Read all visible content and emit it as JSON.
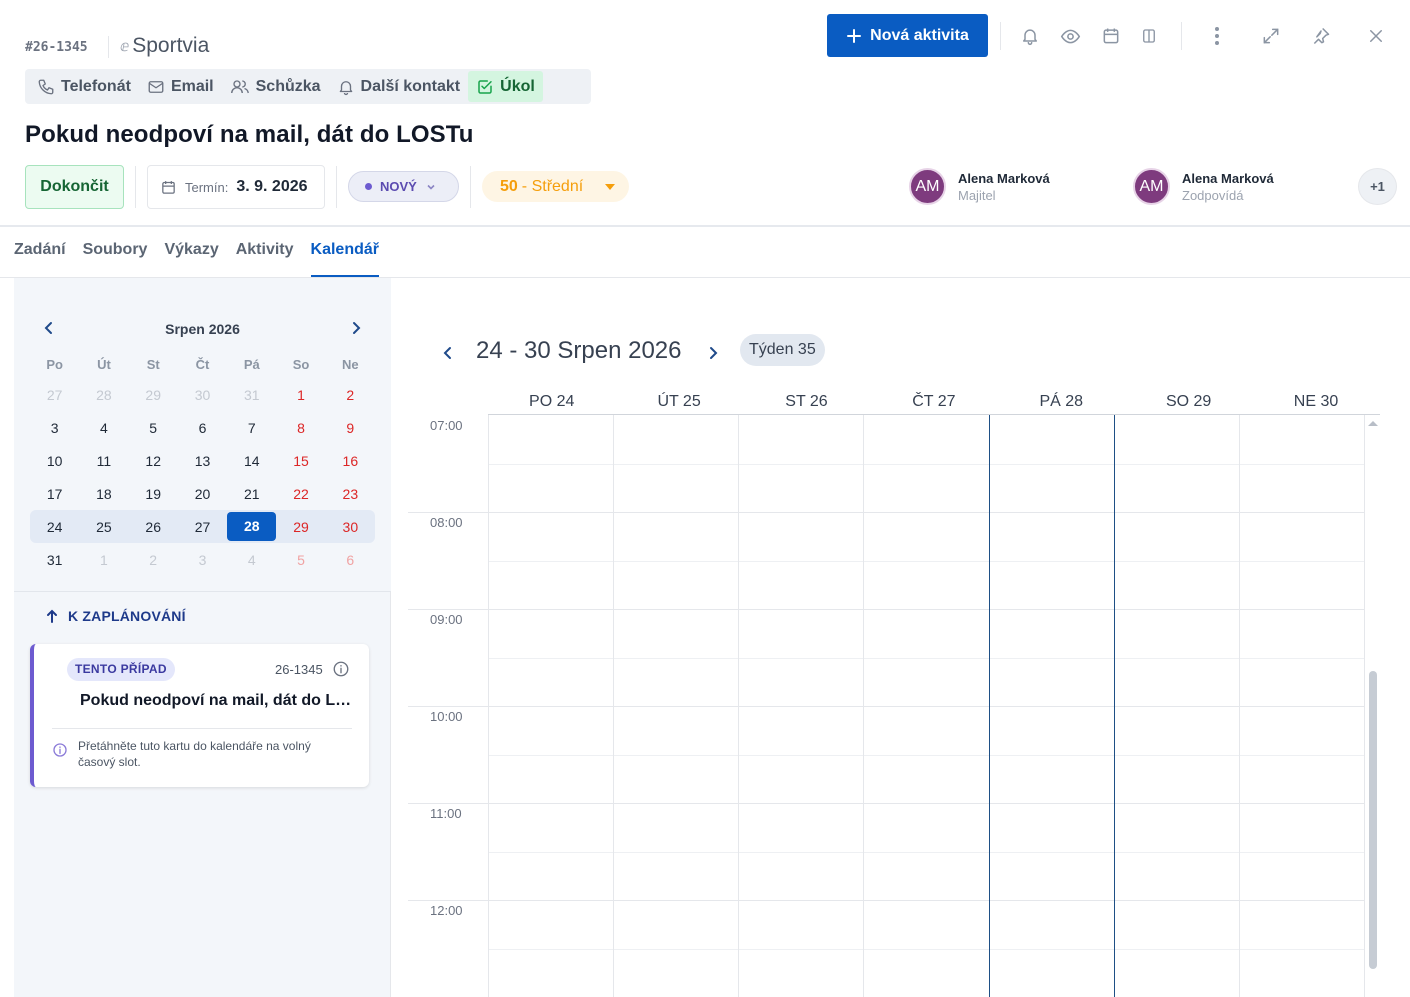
{
  "header": {
    "case_id": "#26-1345",
    "brand": "Sportvia",
    "new_activity_label": "Nová aktivita",
    "activity_types": [
      {
        "label": "Telefonát",
        "icon": "phone-icon"
      },
      {
        "label": "Email",
        "icon": "mail-icon"
      },
      {
        "label": "Schůzka",
        "icon": "users-icon"
      },
      {
        "label": "Další kontakt",
        "icon": "bell-icon"
      },
      {
        "label": "Úkol",
        "icon": "check-square-icon",
        "active": true
      }
    ],
    "toolbar_icons": [
      "bell-icon",
      "eye-icon",
      "calendar-icon",
      "columns-icon",
      "more-vertical-icon",
      "maximize-icon",
      "pin-icon",
      "close-icon"
    ]
  },
  "task": {
    "title": "Pokud neodpoví na mail, dát do LOSTu",
    "finish_label": "Dokončit",
    "deadline_label": "Termín:",
    "deadline_value": "3. 9. 2026",
    "status": "NOVÝ",
    "priority_num": "50",
    "priority_text": "- Střední"
  },
  "people": [
    {
      "initials": "AM",
      "name": "Alena Marková",
      "role": "Majitel"
    },
    {
      "initials": "AM",
      "name": "Alena Marková",
      "role": "Zodpovídá"
    }
  ],
  "more_people": "+1",
  "tabs": [
    {
      "label": "Zadání"
    },
    {
      "label": "Soubory"
    },
    {
      "label": "Výkazy"
    },
    {
      "label": "Aktivity"
    },
    {
      "label": "Kalendář",
      "active": true
    }
  ],
  "mini_calendar": {
    "title": "Srpen 2026",
    "weekdays": [
      "Po",
      "Út",
      "St",
      "Čt",
      "Pá",
      "So",
      "Ne"
    ],
    "weeks": [
      [
        "27",
        "28",
        "29",
        "30",
        "31",
        "1",
        "2"
      ],
      [
        "3",
        "4",
        "5",
        "6",
        "7",
        "8",
        "9"
      ],
      [
        "10",
        "11",
        "12",
        "13",
        "14",
        "15",
        "16"
      ],
      [
        "17",
        "18",
        "19",
        "20",
        "21",
        "22",
        "23"
      ],
      [
        "24",
        "25",
        "26",
        "27",
        "28",
        "29",
        "30"
      ],
      [
        "31",
        "1",
        "2",
        "3",
        "4",
        "5",
        "6"
      ]
    ],
    "today": "28"
  },
  "to_schedule": {
    "heading": "K ZAPLÁNOVÁNÍ",
    "card": {
      "badge": "TENTO PŘÍPAD",
      "id": "26-1345",
      "title": "Pokud neodpoví na mail, dát do LOSTu",
      "hint": "Přetáhněte tuto kartu do kalendáře na volný časový slot."
    }
  },
  "week_view": {
    "title": "24 - 30 Srpen 2026",
    "week_badge": "Týden 35",
    "days": [
      "PO 24",
      "ÚT 25",
      "ST 26",
      "ČT 27",
      "PÁ 28",
      "SO 29",
      "NE 30"
    ],
    "hours": [
      "07:00",
      "08:00",
      "09:00",
      "10:00",
      "11:00",
      "12:00"
    ],
    "selected_day": "PÁ 28"
  },
  "colors": {
    "primary": "#0a5cc2",
    "success_bg": "#ecfbf1",
    "status_purple": "#6d5bd0",
    "priority_orange": "#f59e0b",
    "weekend_red": "#dc2626",
    "avatar": "#7e3b7e"
  }
}
